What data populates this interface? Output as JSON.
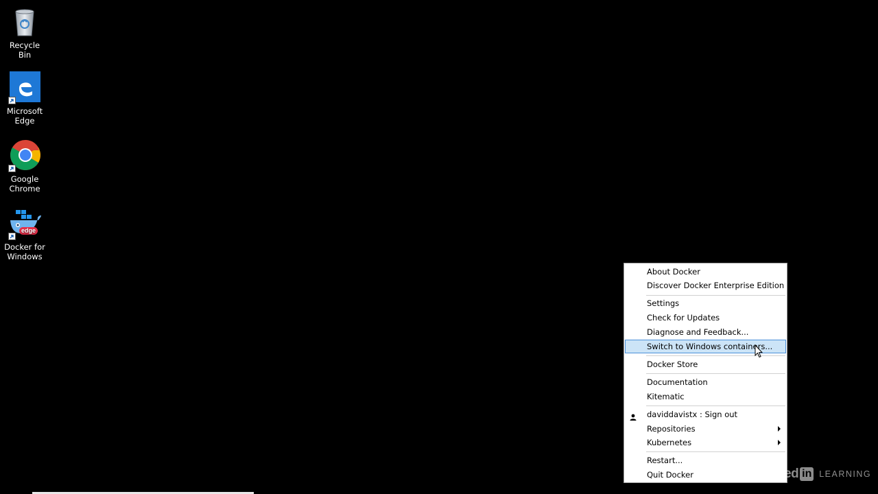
{
  "desktop": {
    "icons": [
      {
        "label": "Recycle Bin",
        "icon": "recycle-bin-icon"
      },
      {
        "label": "Microsoft Edge",
        "icon": "edge-icon"
      },
      {
        "label": "Google Chrome",
        "icon": "chrome-icon"
      },
      {
        "label": "Docker for Windows",
        "icon": "docker-icon",
        "badge": "edge"
      }
    ]
  },
  "menu": {
    "items": [
      {
        "label": "About Docker"
      },
      {
        "label": "Discover Docker Enterprise Edition"
      },
      {
        "label": "Settings"
      },
      {
        "label": "Check for Updates"
      },
      {
        "label": "Diagnose and Feedback..."
      },
      {
        "label": "Switch to Windows containers...",
        "highlighted": true
      },
      {
        "label": "Docker Store"
      },
      {
        "label": "Documentation"
      },
      {
        "label": "Kitematic"
      },
      {
        "label": "daviddavistx : Sign out",
        "icon": "user-icon"
      },
      {
        "label": "Repositories",
        "submenu": true
      },
      {
        "label": "Kubernetes",
        "submenu": true
      },
      {
        "label": "Restart..."
      },
      {
        "label": "Quit Docker"
      }
    ]
  },
  "watermark": {
    "brand": "Linked",
    "in": "in",
    "product": "LEARNING"
  },
  "colors": {
    "desktop_bg": "#000000",
    "menu_bg": "#ffffff",
    "highlight_bg": "#cce4f7",
    "highlight_border": "#4a90d9"
  }
}
